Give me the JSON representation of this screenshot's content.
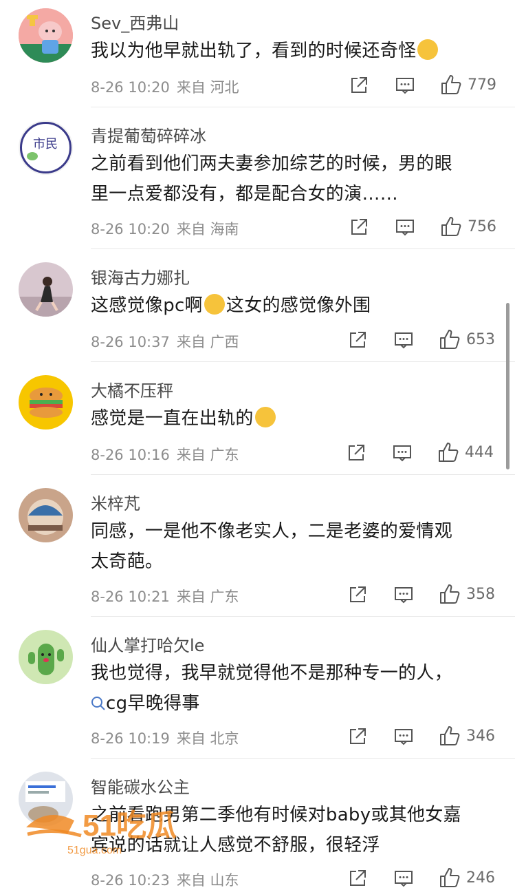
{
  "comments": [
    {
      "username": "Sev_西弗山",
      "lines": [
        "我以为他早就出轨了，看到的时候还奇怪"
      ],
      "date": "8-26 10:20",
      "location": "来自 河北",
      "likes": "779"
    },
    {
      "username": "青提葡萄碎碎冰",
      "lines": [
        "之前看到他们两夫妻参加综艺的时候，男的眼",
        "里一点爱都没有，都是配合女的演……"
      ],
      "date": "8-26 10:20",
      "location": "来自 海南",
      "likes": "756"
    },
    {
      "username": "银海古力娜扎",
      "lines": [
        "这感觉像pc啊",
        "这女的感觉像外围"
      ],
      "date": "8-26 10:37",
      "location": "来自 广西",
      "likes": "653"
    },
    {
      "username": "大橘不压秤",
      "lines": [
        "感觉是一直在出轨的"
      ],
      "date": "8-26 10:16",
      "location": "来自 广东",
      "likes": "444"
    },
    {
      "username": "米梓芃",
      "lines": [
        "同感，一是他不像老实人，二是老婆的爱情观",
        "太奇葩。"
      ],
      "date": "8-26 10:21",
      "location": "来自 广东",
      "likes": "358"
    },
    {
      "username": "仙人掌打哈欠le",
      "lines": [
        "我也觉得，我早就觉得他不是那种专一的人，",
        "cg早晚得事"
      ],
      "date": "8-26 10:19",
      "location": "来自 北京",
      "likes": "346"
    },
    {
      "username": "智能碳水公主",
      "lines": [
        "之前看跑男第二季他有时候对baby或其他女嘉",
        "宾说的话就让人感觉不舒服，很轻浮"
      ],
      "date": "8-26 10:23",
      "location": "来自 山东",
      "likes": "246"
    }
  ],
  "watermark": {
    "logo": "51吃瓜",
    "url": "51gua.com"
  },
  "colors": {
    "username": "#4a4a4a",
    "meta": "#8c8c8c",
    "link": "#4b79c7",
    "divider": "#e8e8e8"
  }
}
